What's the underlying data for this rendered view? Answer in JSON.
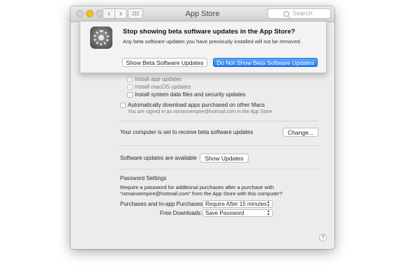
{
  "window": {
    "title": "App Store",
    "search_placeholder": "Search",
    "nav_back": "‹",
    "nav_fwd": "›"
  },
  "alert": {
    "title": "Stop showing beta software updates in the App Store?",
    "message": "Any beta software updates you have previously installed will not be removed.",
    "secondary_button": "Show Beta Software Updates",
    "primary_button": "Do Not Show Beta Software Updates"
  },
  "settings": {
    "options": [
      {
        "label": "Install app updates",
        "checked": false,
        "enabled": false
      },
      {
        "label": "Install macOS updates",
        "checked": false,
        "enabled": false
      },
      {
        "label": "Install system data files and security updates",
        "checked": false,
        "enabled": true
      }
    ],
    "auto_download": {
      "label": "Automatically download apps purchased on other Macs",
      "note": "You are signed in as romansempire@hotmail.com in the App Store",
      "checked": false
    },
    "beta": {
      "text": "Your computer is set to receive beta software updates",
      "button": "Change..."
    },
    "updates": {
      "text": "Software updates are available",
      "button": "Show Updates"
    },
    "password": {
      "heading": "Password Settings",
      "description_line1": "Require a password for additional purchases after a purchase with",
      "description_line2": "“romansempire@hotmail.com” from the App Store with this computer?",
      "purchases_label": "Purchases and In-app Purchases:",
      "purchases_value": "Require After 15 minutes",
      "free_label": "Free Downloads:",
      "free_value": "Save Password"
    },
    "help": "?"
  },
  "colors": {
    "accent": "#1f7bf2",
    "minimize": "#f5bb2f"
  }
}
